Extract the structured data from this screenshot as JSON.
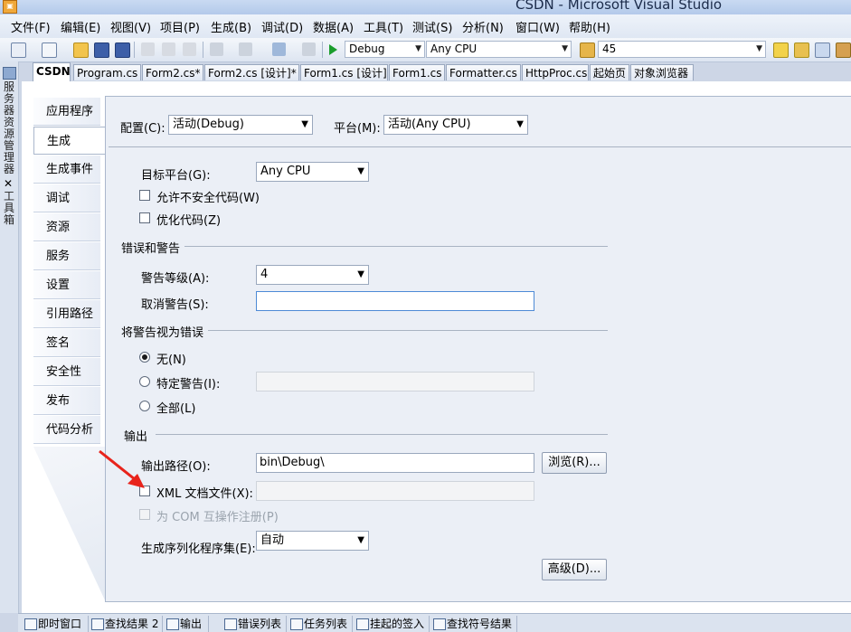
{
  "window": {
    "title": "CSDN - Microsoft Visual Studio"
  },
  "menu": [
    "文件(F)",
    "编辑(E)",
    "视图(V)",
    "项目(P)",
    "生成(B)",
    "调试(D)",
    "数据(A)",
    "工具(T)",
    "测试(S)",
    "分析(N)",
    "窗口(W)",
    "帮助(H)"
  ],
  "toolbar": {
    "config": "Debug",
    "platform": "Any CPU",
    "find": "45"
  },
  "left_strip": {
    "server_explorer": "服务器资源管理器",
    "toolbox": "工具箱"
  },
  "doc_tabs": [
    "CSDN",
    "Program.cs",
    "Form2.cs*",
    "Form2.cs [设计]*",
    "Form1.cs [设计]",
    "Form1.cs",
    "Formatter.cs",
    "HttpProc.cs",
    "起始页",
    "对象浏览器"
  ],
  "side_tabs": [
    "应用程序",
    "生成",
    "生成事件",
    "调试",
    "资源",
    "服务",
    "设置",
    "引用路径",
    "签名",
    "安全性",
    "发布",
    "代码分析"
  ],
  "props": {
    "config_label": "配置(C):",
    "config_value": "活动(Debug)",
    "platform_label": "平台(M):",
    "platform_value": "活动(Any CPU)",
    "target_label": "目标平台(G):",
    "target_value": "Any CPU",
    "unsafe_label": "允许不安全代码(W)",
    "optimize_label": "优化代码(Z)",
    "errors_section": "错误和警告",
    "warn_level_label": "警告等级(A):",
    "warn_level_value": "4",
    "suppress_label": "取消警告(S):",
    "suppress_value": "",
    "treat_section": "将警告视为错误",
    "none_label": "无(N)",
    "specific_label": "特定警告(I):",
    "all_label": "全部(L)",
    "output_section": "输出",
    "output_path_label": "输出路径(O):",
    "output_path_value": "bin\\Debug\\",
    "browse_label": "浏览(R)...",
    "xml_label": "XML 文档文件(X):",
    "com_label": "为 COM 互操作注册(P)",
    "serial_label": "生成序列化程序集(E):",
    "serial_value": "自动",
    "advanced_label": "高级(D)..."
  },
  "bottom_tabs": [
    "即时窗口",
    "查找结果 2",
    "输出",
    "错误列表",
    "任务列表",
    "挂起的签入",
    "查找符号结果"
  ],
  "colors": {
    "arrow": "#e8231b",
    "accent": "#4d8ad6"
  }
}
